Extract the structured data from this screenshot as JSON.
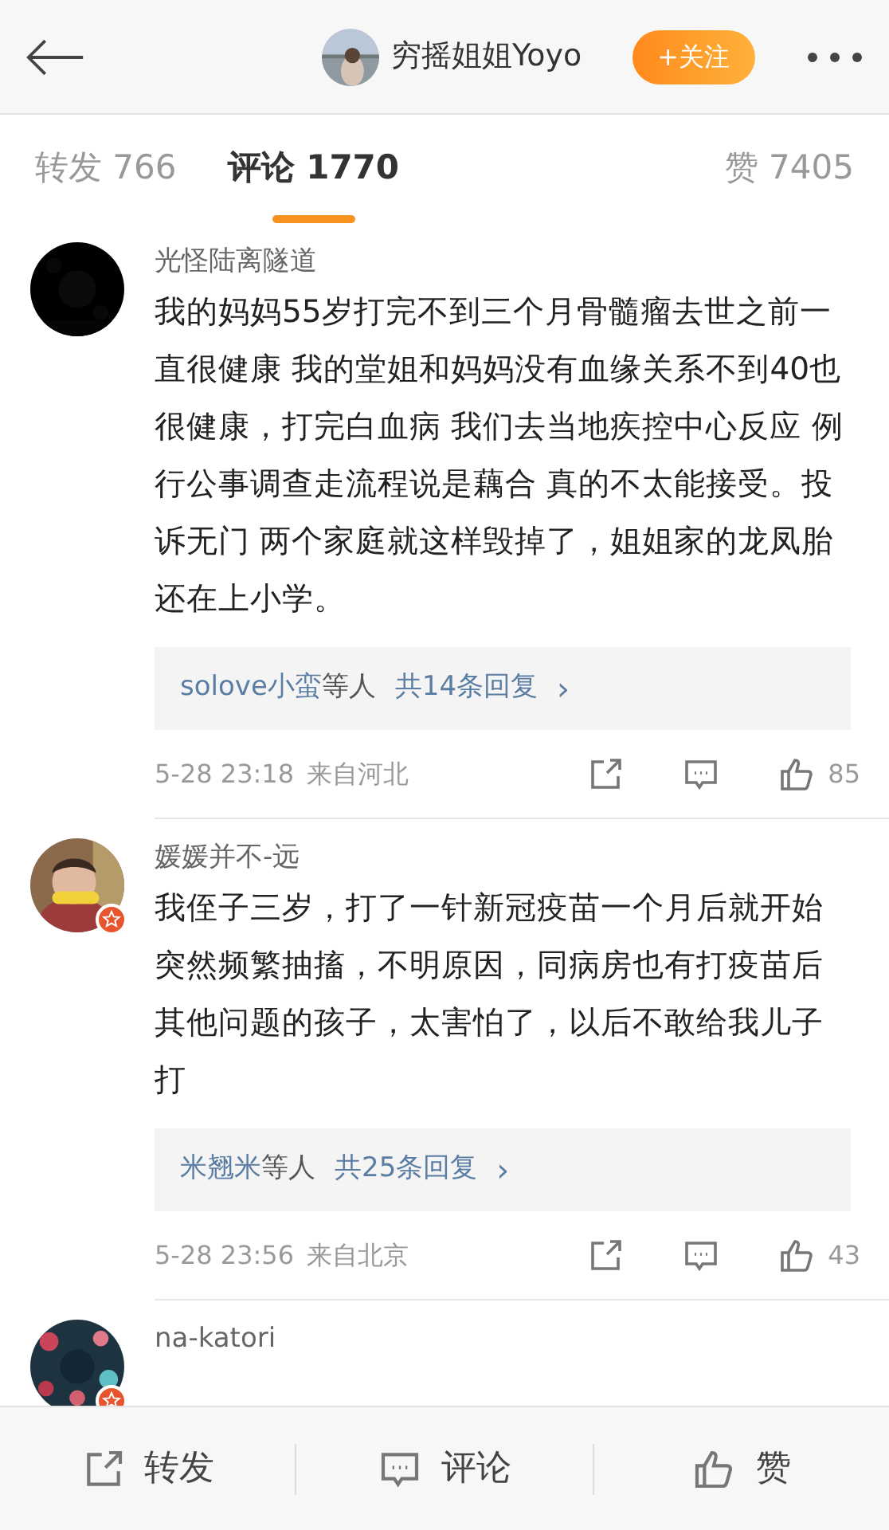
{
  "header": {
    "username": "穷摇姐姐Yoyo",
    "follow_label": "+关注"
  },
  "tabs": [
    {
      "label": "转发 766",
      "selected": false
    },
    {
      "label": "评论 1770",
      "selected": true
    },
    {
      "label": "赞 7405",
      "selected": false
    }
  ],
  "comments": [
    {
      "badge": false,
      "user": "光怪陆离隧道",
      "text": "我的妈妈55岁打完不到三个月骨髓瘤去世之前一直很健康 我的堂姐和妈妈没有血缘关系不到40也很健康，打完白血病 我们去当地疾控中心反应 例行公事调查走流程说是藕合 真的不太能接受。投诉无门 两个家庭就这样毁掉了，姐姐家的龙凤胎还在上小学。",
      "replies_by": "solove小蛮",
      "replies_suffix": "等人",
      "replies_count": "共14条回复",
      "replies_arrow": "›",
      "time": "5-28 23:18",
      "source": "来自河北",
      "likes": "85"
    },
    {
      "badge": true,
      "user": "媛媛并不-远",
      "text": "我侄子三岁，打了一针新冠疫苗一个月后就开始突然频繁抽搐，不明原因，同病房也有打疫苗后其他问题的孩子，太害怕了，以后不敢给我儿子打",
      "replies_by": "米翘米",
      "replies_suffix": "等人",
      "replies_count": "共25条回复",
      "replies_arrow": "›",
      "time": "5-28 23:56",
      "source": "来自北京",
      "likes": "43"
    },
    {
      "badge": true,
      "user": "na-katori"
    }
  ],
  "bottom_bar": [
    {
      "kind": "repost",
      "label": "转发"
    },
    {
      "kind": "comment",
      "label": "评论"
    },
    {
      "kind": "like",
      "label": "赞"
    }
  ]
}
